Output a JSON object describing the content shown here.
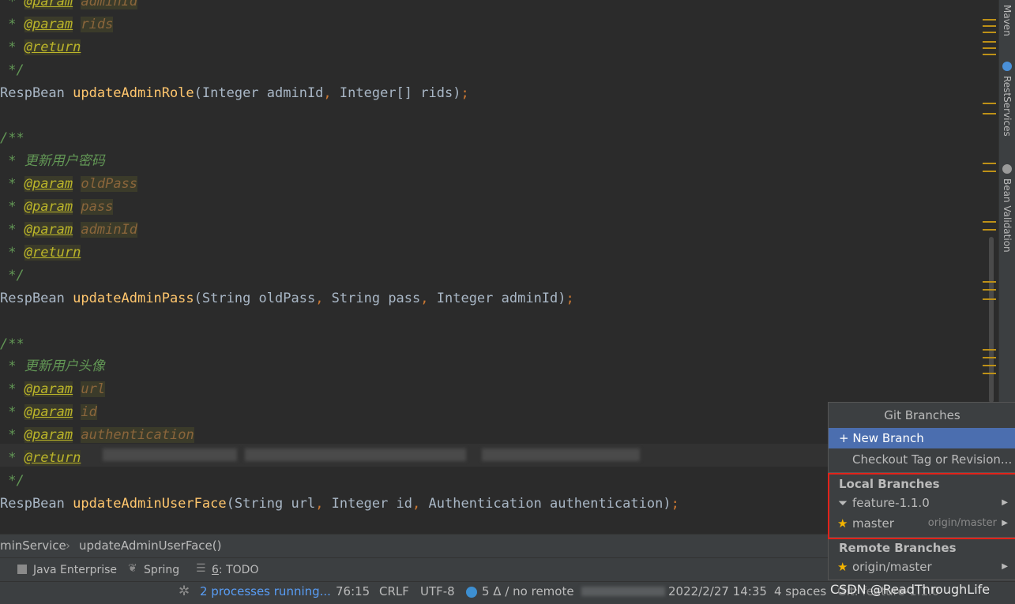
{
  "editor": {
    "lines": [
      {
        "parts": [
          [
            "cm",
            " * "
          ],
          [
            "tag",
            "@param"
          ],
          [
            "cm",
            " "
          ],
          [
            "pv",
            "adminId"
          ]
        ]
      },
      {
        "parts": [
          [
            "cm",
            " * "
          ],
          [
            "tag",
            "@param"
          ],
          [
            "cm",
            " "
          ],
          [
            "pv",
            "rids"
          ]
        ]
      },
      {
        "parts": [
          [
            "cm",
            " * "
          ],
          [
            "tag",
            "@return"
          ]
        ]
      },
      {
        "parts": [
          [
            "cm",
            " */"
          ]
        ]
      },
      {
        "parts": [
          [
            "tx",
            "RespBean "
          ],
          [
            "fn",
            "updateAdminRole"
          ],
          [
            "tx",
            "(Integer adminId"
          ],
          [
            "op",
            ", "
          ],
          [
            "tx",
            "Integer[] rids)"
          ],
          [
            "op",
            ";"
          ]
        ]
      },
      {
        "parts": []
      },
      {
        "parts": [
          [
            "cm",
            "/**"
          ]
        ]
      },
      {
        "parts": [
          [
            "cm",
            " * 更新用户密码"
          ]
        ]
      },
      {
        "parts": [
          [
            "cm",
            " * "
          ],
          [
            "tag",
            "@param"
          ],
          [
            "cm",
            " "
          ],
          [
            "pv",
            "oldPass"
          ]
        ]
      },
      {
        "parts": [
          [
            "cm",
            " * "
          ],
          [
            "tag",
            "@param"
          ],
          [
            "cm",
            " "
          ],
          [
            "pv",
            "pass"
          ]
        ]
      },
      {
        "parts": [
          [
            "cm",
            " * "
          ],
          [
            "tag",
            "@param"
          ],
          [
            "cm",
            " "
          ],
          [
            "pv",
            "adminId"
          ]
        ]
      },
      {
        "parts": [
          [
            "cm",
            " * "
          ],
          [
            "tag",
            "@return"
          ]
        ]
      },
      {
        "parts": [
          [
            "cm",
            " */"
          ]
        ]
      },
      {
        "parts": [
          [
            "tx",
            "RespBean "
          ],
          [
            "fn",
            "updateAdminPass"
          ],
          [
            "tx",
            "(String oldPass"
          ],
          [
            "op",
            ", "
          ],
          [
            "tx",
            "String pass"
          ],
          [
            "op",
            ", "
          ],
          [
            "tx",
            "Integer adminId)"
          ],
          [
            "op",
            ";"
          ]
        ]
      },
      {
        "parts": []
      },
      {
        "parts": [
          [
            "cm",
            "/**"
          ]
        ]
      },
      {
        "parts": [
          [
            "cm",
            " * 更新用户头像"
          ]
        ]
      },
      {
        "parts": [
          [
            "cm",
            " * "
          ],
          [
            "tag",
            "@param"
          ],
          [
            "cm",
            " "
          ],
          [
            "pv",
            "url"
          ]
        ]
      },
      {
        "parts": [
          [
            "cm",
            " * "
          ],
          [
            "tag",
            "@param"
          ],
          [
            "cm",
            " "
          ],
          [
            "pv",
            "id"
          ]
        ]
      },
      {
        "parts": [
          [
            "cm",
            " * "
          ],
          [
            "tag",
            "@param"
          ],
          [
            "cm",
            " "
          ],
          [
            "pv",
            "authentication"
          ]
        ]
      },
      {
        "parts": [
          [
            "cm",
            " * "
          ],
          [
            "tag",
            "@return"
          ]
        ]
      },
      {
        "parts": [
          [
            "cm",
            " */"
          ]
        ]
      },
      {
        "parts": [
          [
            "tx",
            "RespBean "
          ],
          [
            "fn",
            "updateAdminUserFace"
          ],
          [
            "tx",
            "(String url"
          ],
          [
            "op",
            ", "
          ],
          [
            "tx",
            "Integer id"
          ],
          [
            "op",
            ", "
          ],
          [
            "tx",
            "Authentication authentication)"
          ],
          [
            "op",
            ";"
          ]
        ]
      }
    ]
  },
  "right_tools": {
    "maven": "Maven",
    "rest": "RestServices",
    "bean": "Bean Validation"
  },
  "breadcrumb": {
    "class": "minService",
    "method": "updateAdminUserFace()"
  },
  "toolwindows": {
    "java_enterprise": "Java Enterprise",
    "spring": "Spring",
    "todo_num": "6",
    "todo_label": ": TODO"
  },
  "status": {
    "processes": "2 processes running...",
    "position": "76:15",
    "line_sep": "CRLF",
    "encoding": "UTF-8",
    "vcs": "5 Δ / no remote",
    "datetime": "2022/2/27 14:35",
    "indent": "4 spaces",
    "branch": "Git: feature-1.1.0",
    "watermark": "CSDN @ReadThroughLife"
  },
  "git_popup": {
    "title": "Git Branches",
    "new_branch": "+ New Branch",
    "checkout": "Checkout Tag or Revision...",
    "local_header": "Local Branches",
    "local": [
      {
        "name": "feature-1.1.0",
        "tracking": ""
      },
      {
        "name": "master",
        "tracking": "origin/master"
      }
    ],
    "remote_header": "Remote Branches",
    "remote": [
      {
        "name": "origin/master"
      }
    ],
    "colors": {
      "selected": "#4b6eaf",
      "highlight_box": "#e2231a",
      "star": "#f4b400"
    }
  }
}
